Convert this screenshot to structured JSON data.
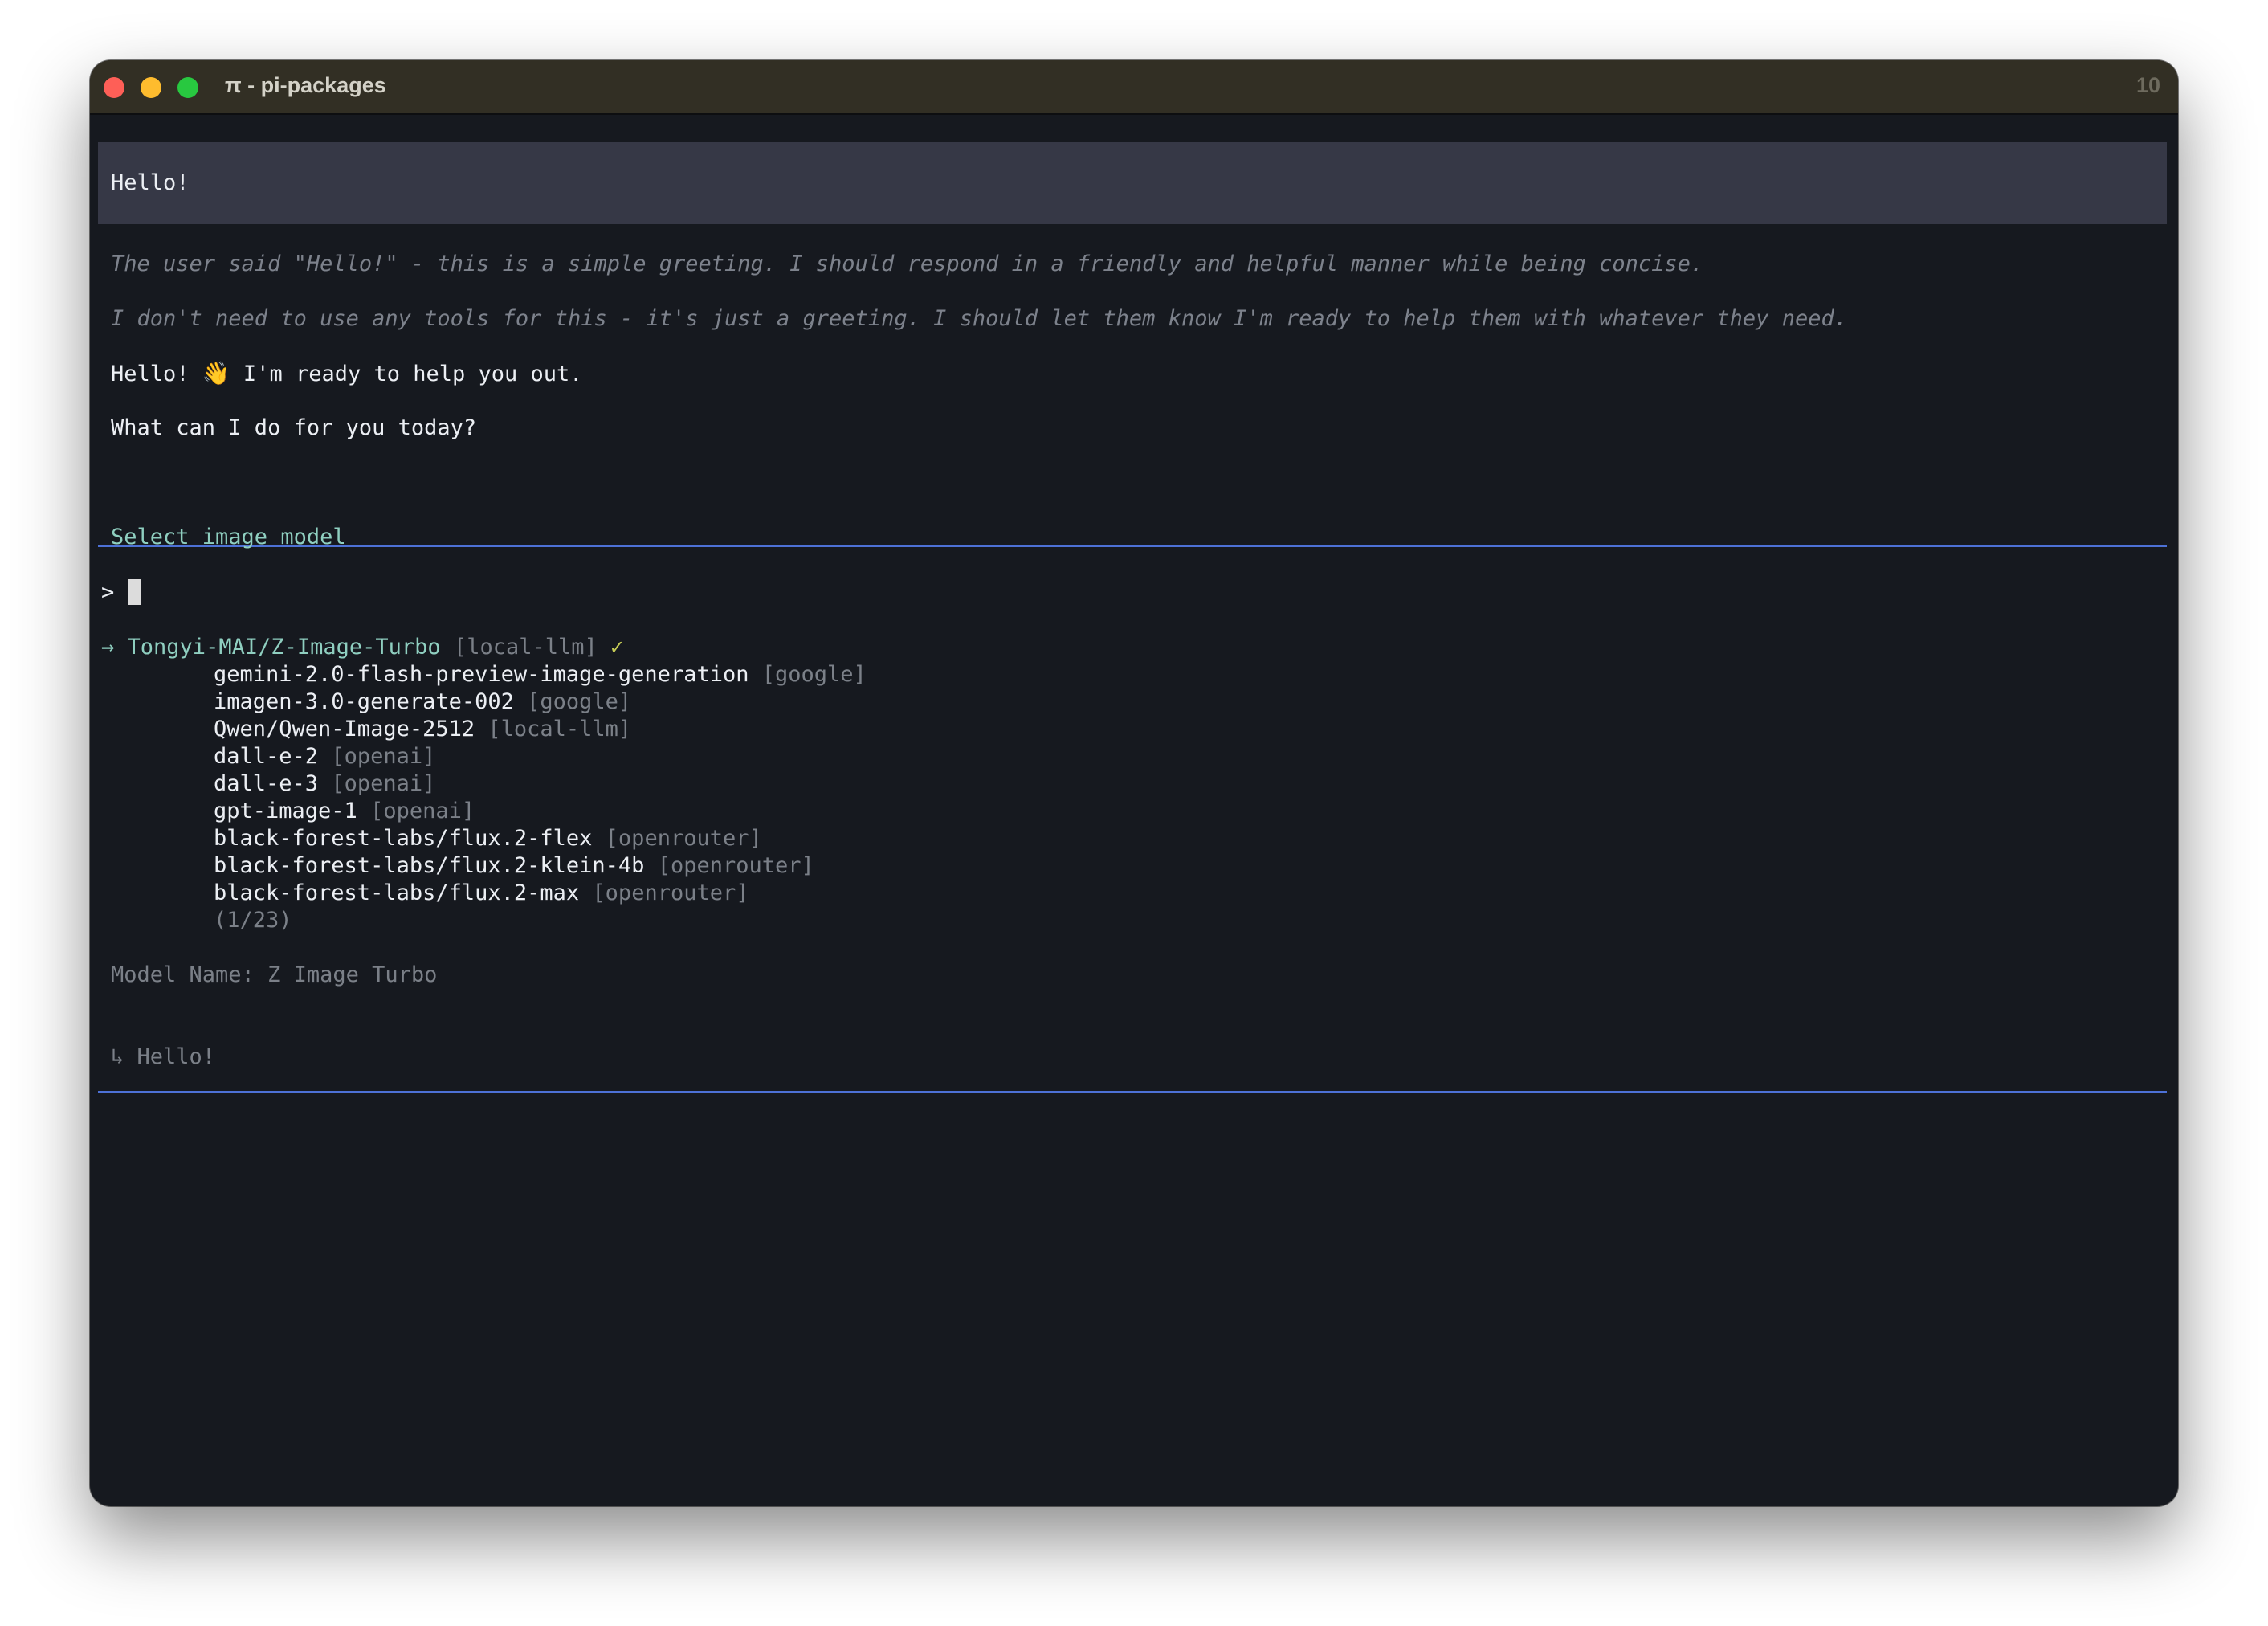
{
  "window": {
    "title": "π - pi-packages",
    "number": "10"
  },
  "chat": {
    "user_message": "Hello!",
    "thinking": [
      "The user said \"Hello!\" - this is a simple greeting. I should respond in a friendly and helpful manner while being concise.",
      "I don't need to use any tools for this - it's just a greeting. I should let them know I'm ready to help them with whatever they need."
    ],
    "reply_greeting": "Hello! ",
    "reply_emoji": "👋",
    "reply_rest": " I'm ready to help you out.",
    "reply_question": "What can I do for you today?"
  },
  "selector": {
    "title": "Select image model",
    "prompt": ">",
    "selected_marker": "→",
    "selected_check": "✓",
    "items": [
      {
        "name": "Tongyi-MAI/Z-Image-Turbo",
        "provider": "[local-llm]"
      },
      {
        "name": "gemini-2.0-flash-preview-image-generation",
        "provider": "[google]"
      },
      {
        "name": "imagen-3.0-generate-002",
        "provider": "[google]"
      },
      {
        "name": "Qwen/Qwen-Image-2512",
        "provider": "[local-llm]"
      },
      {
        "name": "dall-e-2",
        "provider": "[openai]"
      },
      {
        "name": "dall-e-3",
        "provider": "[openai]"
      },
      {
        "name": "gpt-image-1",
        "provider": "[openai]"
      },
      {
        "name": "black-forest-labs/flux.2-flex",
        "provider": "[openrouter]"
      },
      {
        "name": "black-forest-labs/flux.2-klein-4b",
        "provider": "[openrouter]"
      },
      {
        "name": "black-forest-labs/flux.2-max",
        "provider": "[openrouter]"
      }
    ],
    "count": "(1/23)",
    "detail": "Model Name: Z Image Turbo"
  },
  "input": {
    "arrow": "↳",
    "text": "Hello!"
  },
  "colors": {
    "accent": "#8fcfc0",
    "rule": "#4d71d6",
    "check": "#c6cc55",
    "background": "#16191f"
  }
}
